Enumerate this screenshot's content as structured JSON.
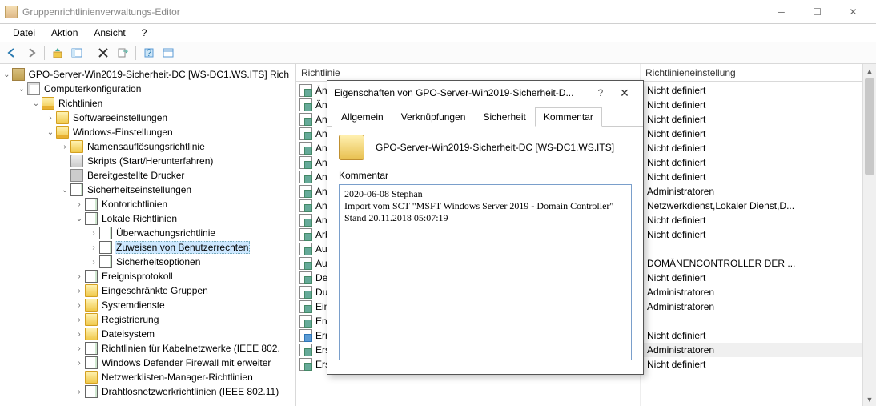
{
  "window": {
    "title": "Gruppenrichtlinienverwaltungs-Editor"
  },
  "menu": {
    "items": [
      "Datei",
      "Aktion",
      "Ansicht",
      "?"
    ]
  },
  "tree": {
    "root": "GPO-Server-Win2019-Sicherheit-DC [WS-DC1.WS.ITS] Rich",
    "computerconfig": "Computerkonfiguration",
    "richtlinien": "Richtlinien",
    "software": "Softwareeinstellungen",
    "windows": "Windows-Einstellungen",
    "namens": "Namensauflösungsrichtlinie",
    "skripts": "Skripts (Start/Herunterfahren)",
    "drucker": "Bereitgestellte Drucker",
    "sicherheit": "Sicherheitseinstellungen",
    "konto": "Kontorichtlinien",
    "lokal": "Lokale Richtlinien",
    "ueberwachung": "Überwachungsrichtlinie",
    "zuweisen": "Zuweisen von Benutzerrechten",
    "sicherheitsopt": "Sicherheitsoptionen",
    "ereignis": "Ereignisprotokoll",
    "eingeschraenkt": "Eingeschränkte Gruppen",
    "systemdienste": "Systemdienste",
    "registrierung": "Registrierung",
    "dateisystem": "Dateisystem",
    "kabel": "Richtlinien für Kabelnetzwerke (IEEE 802.",
    "defender": "Windows Defender Firewall mit erweiter",
    "netzwerklisten": "Netzwerklisten-Manager-Richtlinien",
    "drahtlos": "Drahtlosnetzwerkrichtlinien (IEEE 802.11)"
  },
  "list": {
    "col1_header": "Richtlinie",
    "col2_header": "Richtlinieneinstellung",
    "rows": [
      {
        "name": "Änd",
        "setting": "Nicht definiert"
      },
      {
        "name": "Änd",
        "setting": "Nicht definiert"
      },
      {
        "name": "An",
        "setting": "Nicht definiert"
      },
      {
        "name": "Ann",
        "setting": "Nicht definiert"
      },
      {
        "name": "Ann",
        "setting": "Nicht definiert"
      },
      {
        "name": "An",
        "setting": "Nicht definiert"
      },
      {
        "name": "An",
        "setting": "Nicht definiert"
      },
      {
        "name": "Anp",
        "setting": "Administratoren"
      },
      {
        "name": "Anp",
        "setting": "Netzwerkdienst,Lokaler Dienst,D..."
      },
      {
        "name": "Anp",
        "setting": "Nicht definiert"
      },
      {
        "name": "Arb",
        "setting": "Nicht definiert"
      },
      {
        "name": "Auf",
        "setting": ""
      },
      {
        "name": "Aus",
        "setting": "DOMÄNENCONTROLLER DER ..."
      },
      {
        "name": "Deb",
        "setting": "Nicht definiert"
      },
      {
        "name": "Durc",
        "setting": "Administratoren"
      },
      {
        "name": "Ein",
        "setting": "Administratoren"
      },
      {
        "name": "Entf",
        "setting": ""
      },
      {
        "name": "Erm",
        "setting": "Nicht definiert"
      },
      {
        "name": "Ers",
        "setting": "Administratoren"
      },
      {
        "name": "Ers",
        "setting": "Nicht definiert"
      }
    ],
    "selected_setting_index": 18
  },
  "dialog": {
    "title": "Eigenschaften von GPO-Server-Win2019-Sicherheit-D...",
    "tabs": [
      "Allgemein",
      "Verknüpfungen",
      "Sicherheit",
      "Kommentar"
    ],
    "active_tab": 3,
    "gpo_name": "GPO-Server-Win2019-Sicherheit-DC [WS-DC1.WS.ITS]",
    "comment_label": "Kommentar",
    "comment_text": "2020-06-08 Stephan\nImport vom SCT \"MSFT Windows Server 2019 - Domain Controller\"\nStand 20.11.2018 05:07:19"
  }
}
